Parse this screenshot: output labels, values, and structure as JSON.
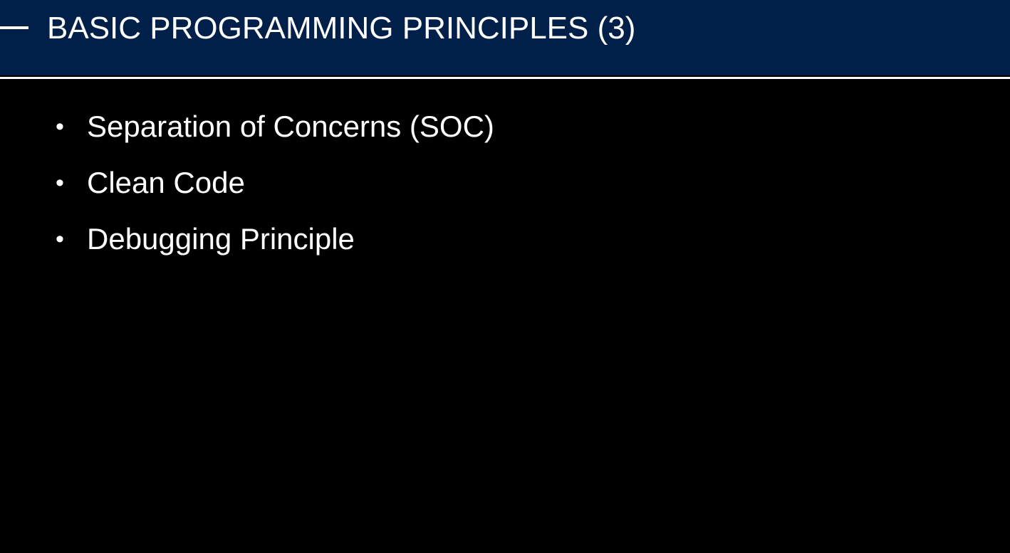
{
  "slide": {
    "title": "BASIC PROGRAMMING PRINCIPLES (3)",
    "bullet_symbol": "•",
    "items": [
      {
        "label": "Separation of Concerns (SOC)"
      },
      {
        "label": "Clean Code"
      },
      {
        "label": "Debugging Principle"
      }
    ]
  },
  "colors": {
    "header_background": "#00204a",
    "slide_background": "#000000",
    "text": "#ffffff"
  }
}
